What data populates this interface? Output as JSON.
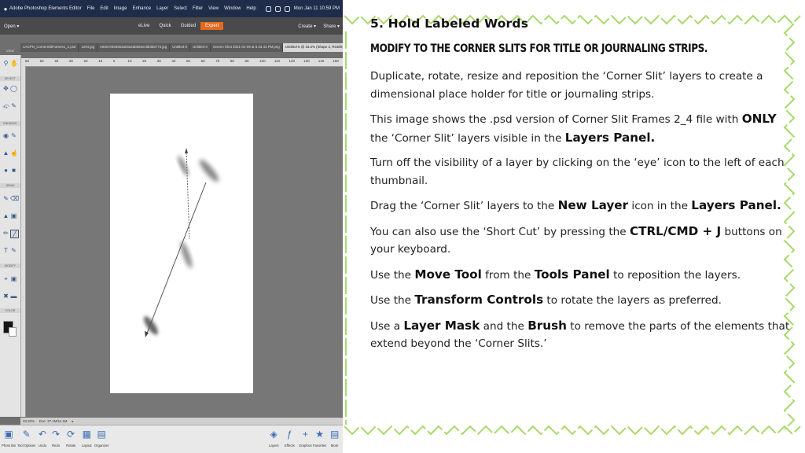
{
  "screenshot": {
    "menubar": {
      "items": [
        "Adobe Photoshop Elements Editor",
        "File",
        "Edit",
        "Image",
        "Enhance",
        "Layer",
        "Select",
        "Filter",
        "View",
        "Window",
        "Help"
      ],
      "clock": "Mon Jan 11 10:59 PM"
    },
    "topbar": {
      "open": "Open",
      "modes": [
        "eLive",
        "Quick",
        "Guided",
        "Expert"
      ],
      "active_mode": "Expert",
      "create": "Create",
      "share": "Share"
    },
    "view_label": "VIEW",
    "tabs": [
      "4AGPN_CornerSlitFrames1_2.psd",
      "1294.jpg",
      "e8467eb9d953a03a4abb55ec8b3b6774.jpg",
      "Untitled-3",
      "Untitled-4",
      "Screen Shot 2021-01-09 at 8.43.43 PM.png",
      "Untitled-5 @ 33.3% (Shape 2, RGB/8)"
    ],
    "ruler_ticks": [
      "60",
      "50",
      "40",
      "30",
      "20",
      "10",
      "0",
      "10",
      "20",
      "30",
      "40",
      "50",
      "60",
      "70",
      "80",
      "90",
      "100",
      "110",
      "120",
      "130",
      "140",
      "150"
    ],
    "tool_sections": [
      "SELECT",
      "ENHANCE",
      "DRAW",
      "MODIFY",
      "COLOR"
    ],
    "status": {
      "zoom": "33.33%",
      "doc": "Doc: 37.1M/11.1M"
    },
    "bottom_left": [
      {
        "label": "Photo Bin",
        "icon": "photo-bin-icon"
      },
      {
        "label": "Tool Options",
        "icon": "tool-options-icon"
      },
      {
        "label": "Undo",
        "icon": "undo-icon"
      },
      {
        "label": "Redo",
        "icon": "redo-icon"
      },
      {
        "label": "Rotate",
        "icon": "rotate-icon"
      },
      {
        "label": "Layout",
        "icon": "layout-icon"
      },
      {
        "label": "Organizer",
        "icon": "organizer-icon"
      }
    ],
    "bottom_right": [
      {
        "label": "Layers",
        "icon": "layers-icon"
      },
      {
        "label": "Effects",
        "icon": "effects-icon"
      },
      {
        "label": "Graphics",
        "icon": "graphics-icon"
      },
      {
        "label": "Favorites",
        "icon": "favorites-icon"
      },
      {
        "label": "More",
        "icon": "more-icon"
      }
    ]
  },
  "slide": {
    "heading": "5. Hold Labeled Words",
    "subheading": "MODIFY TO THE CORNER SLITS FOR TITLE OR JOURNALING STRIPS.",
    "accent_color": "#a9d96b",
    "paragraphs": {
      "p1": "Duplicate, rotate, resize and reposition the ‘Corner Slit’ layers to create a dimensional place holder for title or journaling strips.",
      "p2a": "This image shows the .psd version of Corner Slit Frames 2_4 file with ",
      "p2b": "ONLY",
      "p2c": " the ‘Corner Slit’ layers visible in the ",
      "p2d": "Layers Panel.",
      "p3": "Turn off the visibility of a layer by clicking on the ‘eye’ icon to the left of each thumbnail.",
      "p4a": "Drag the ‘Corner Slit’ layers to the ",
      "p4b": "New Layer",
      "p4c": " icon in the ",
      "p4d": "Layers Panel.",
      "p5a": "You can also use the ‘Short Cut’ by pressing the ",
      "p5b": "CTRL/CMD + J",
      "p5c": " buttons on your keyboard.",
      "p6a": "Use the ",
      "p6b": "Move Tool",
      "p6c": " from the ",
      "p6d": "Tools Panel",
      "p6e": " to reposition the layers.",
      "p7a": "Use the ",
      "p7b": "Transform Controls",
      "p7c": " to rotate the layers as preferred.",
      "p8a": "Use a ",
      "p8b": "Layer Mask",
      "p8c": " and the ",
      "p8d": "Brush",
      "p8e": " to remove the parts of the elements that extend beyond the ‘Corner Slits.’"
    }
  }
}
